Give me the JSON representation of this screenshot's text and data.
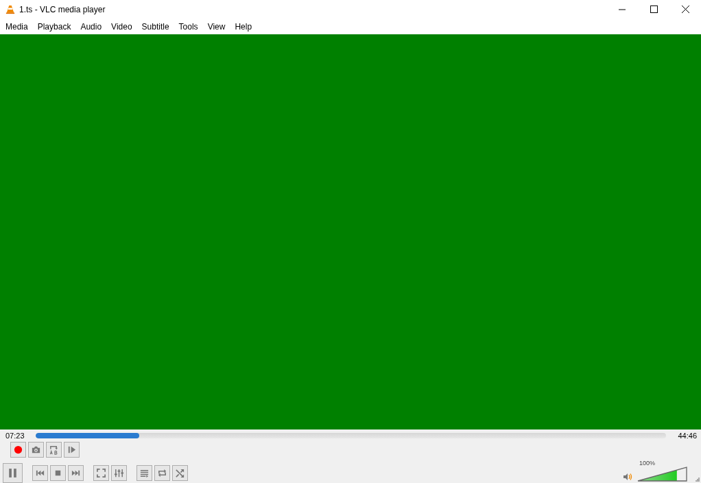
{
  "window": {
    "title": "1.ts - VLC media player"
  },
  "menu": [
    "Media",
    "Playback",
    "Audio",
    "Video",
    "Subtitle",
    "Tools",
    "View",
    "Help"
  ],
  "seek": {
    "elapsed": "07:23",
    "total": "44:46",
    "level": 0.165
  },
  "controls_top": [
    {
      "kind": "record"
    },
    {
      "kind": "snapshot"
    },
    {
      "kind": "loop_ab"
    },
    {
      "kind": "frame"
    }
  ],
  "controls_bottom": [
    [
      {
        "kind": "pause"
      }
    ],
    [
      {
        "kind": "prev"
      },
      {
        "kind": "stop"
      },
      {
        "kind": "next"
      }
    ],
    [
      {
        "kind": "fullscreen"
      },
      {
        "kind": "extended"
      }
    ],
    [
      {
        "kind": "playlist"
      },
      {
        "kind": "loop"
      },
      {
        "kind": "shuffle"
      }
    ]
  ],
  "volume": {
    "reading": "100%",
    "level": 0.8
  }
}
